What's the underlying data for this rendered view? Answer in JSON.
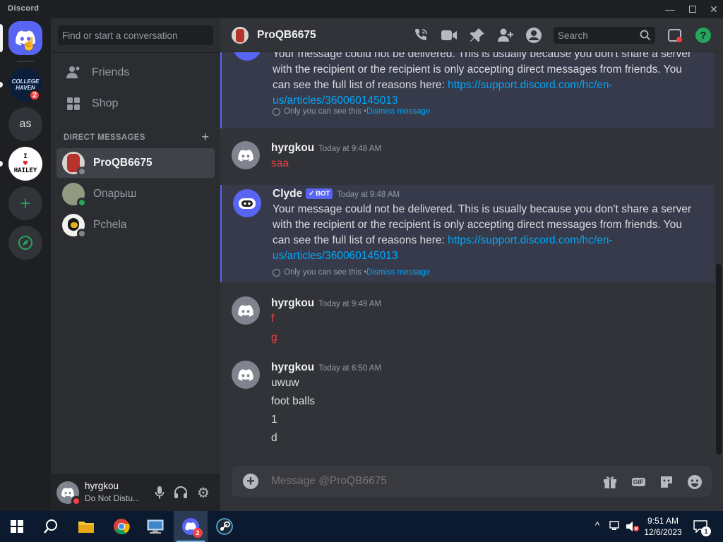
{
  "app": {
    "title": "Discord"
  },
  "colors": {
    "accent": "#5865f2",
    "link": "#00a8fc",
    "danger": "#f23f42",
    "online": "#23a55a",
    "idle_offline": "#80848e"
  },
  "rail": {
    "servers": [
      {
        "name": "home",
        "icon": "discord-logo-icon"
      },
      {
        "name": "COLLEGE HAVEN",
        "icon": "college-haven-icon",
        "badge": "2"
      },
      {
        "name": "as",
        "label": "as"
      },
      {
        "name": "I HAILEY",
        "icon": "i-heart-hailey-icon",
        "label_top": "I",
        "label_bottom": "HAILEY"
      },
      {
        "name": "add-server",
        "icon": "plus-icon"
      },
      {
        "name": "explore",
        "icon": "compass-icon"
      }
    ]
  },
  "sidebar": {
    "search_placeholder": "Find or start a conversation",
    "nav": [
      {
        "label": "Friends",
        "icon": "friends-icon"
      },
      {
        "label": "Shop",
        "icon": "shop-icon"
      }
    ],
    "dm_header": "DIRECT MESSAGES",
    "dms": [
      {
        "name": "ProQB6675",
        "status": "offline",
        "active": true
      },
      {
        "name": "Опарыш",
        "status": "online"
      },
      {
        "name": "Pchela",
        "status": "offline"
      }
    ],
    "user": {
      "name": "hyrgkou",
      "status": "Do Not Distu..."
    }
  },
  "header": {
    "recipient": "ProQB6675",
    "search_placeholder": "Search"
  },
  "messages": [
    {
      "type": "clyde-continued",
      "text_1": "Your message could not be delivered. This is usually because you don't share a server with the recipient or the recipient is only accepting direct messages from friends. You can see the full list of reasons here: ",
      "link": "https://support.discord.com/hc/en-us/articles/360060145013",
      "note": "Only you can see this • ",
      "dismiss": "Dismiss message"
    },
    {
      "type": "user",
      "author": "hyrgkou",
      "time": "Today at 9:48 AM",
      "lines": [
        "saa"
      ],
      "failed": true
    },
    {
      "type": "clyde",
      "author": "Clyde",
      "badge": "BOT",
      "time": "Today at 9:48 AM",
      "text_1": "Your message could not be delivered. This is usually because you don't share a server with the recipient or the recipient is only accepting direct messages from friends. You can see the full list of reasons here: ",
      "link": "https://support.discord.com/hc/en-us/articles/360060145013",
      "note": "Only you can see this • ",
      "dismiss": "Dismiss message"
    },
    {
      "type": "user",
      "author": "hyrgkou",
      "time": "Today at 9:49 AM",
      "lines": [
        "f",
        "g"
      ],
      "failed": true
    },
    {
      "type": "user",
      "author": "hyrgkou",
      "time": "Today at 6:50 AM",
      "lines": [
        "uwuw",
        "foot balls",
        "1",
        "d"
      ],
      "failed": false
    }
  ],
  "composer": {
    "placeholder": "Message @ProQB6675"
  },
  "taskbar": {
    "time": "9:51 AM",
    "date": "12/6/2023",
    "notifications": "1",
    "discord_badge": "2"
  }
}
